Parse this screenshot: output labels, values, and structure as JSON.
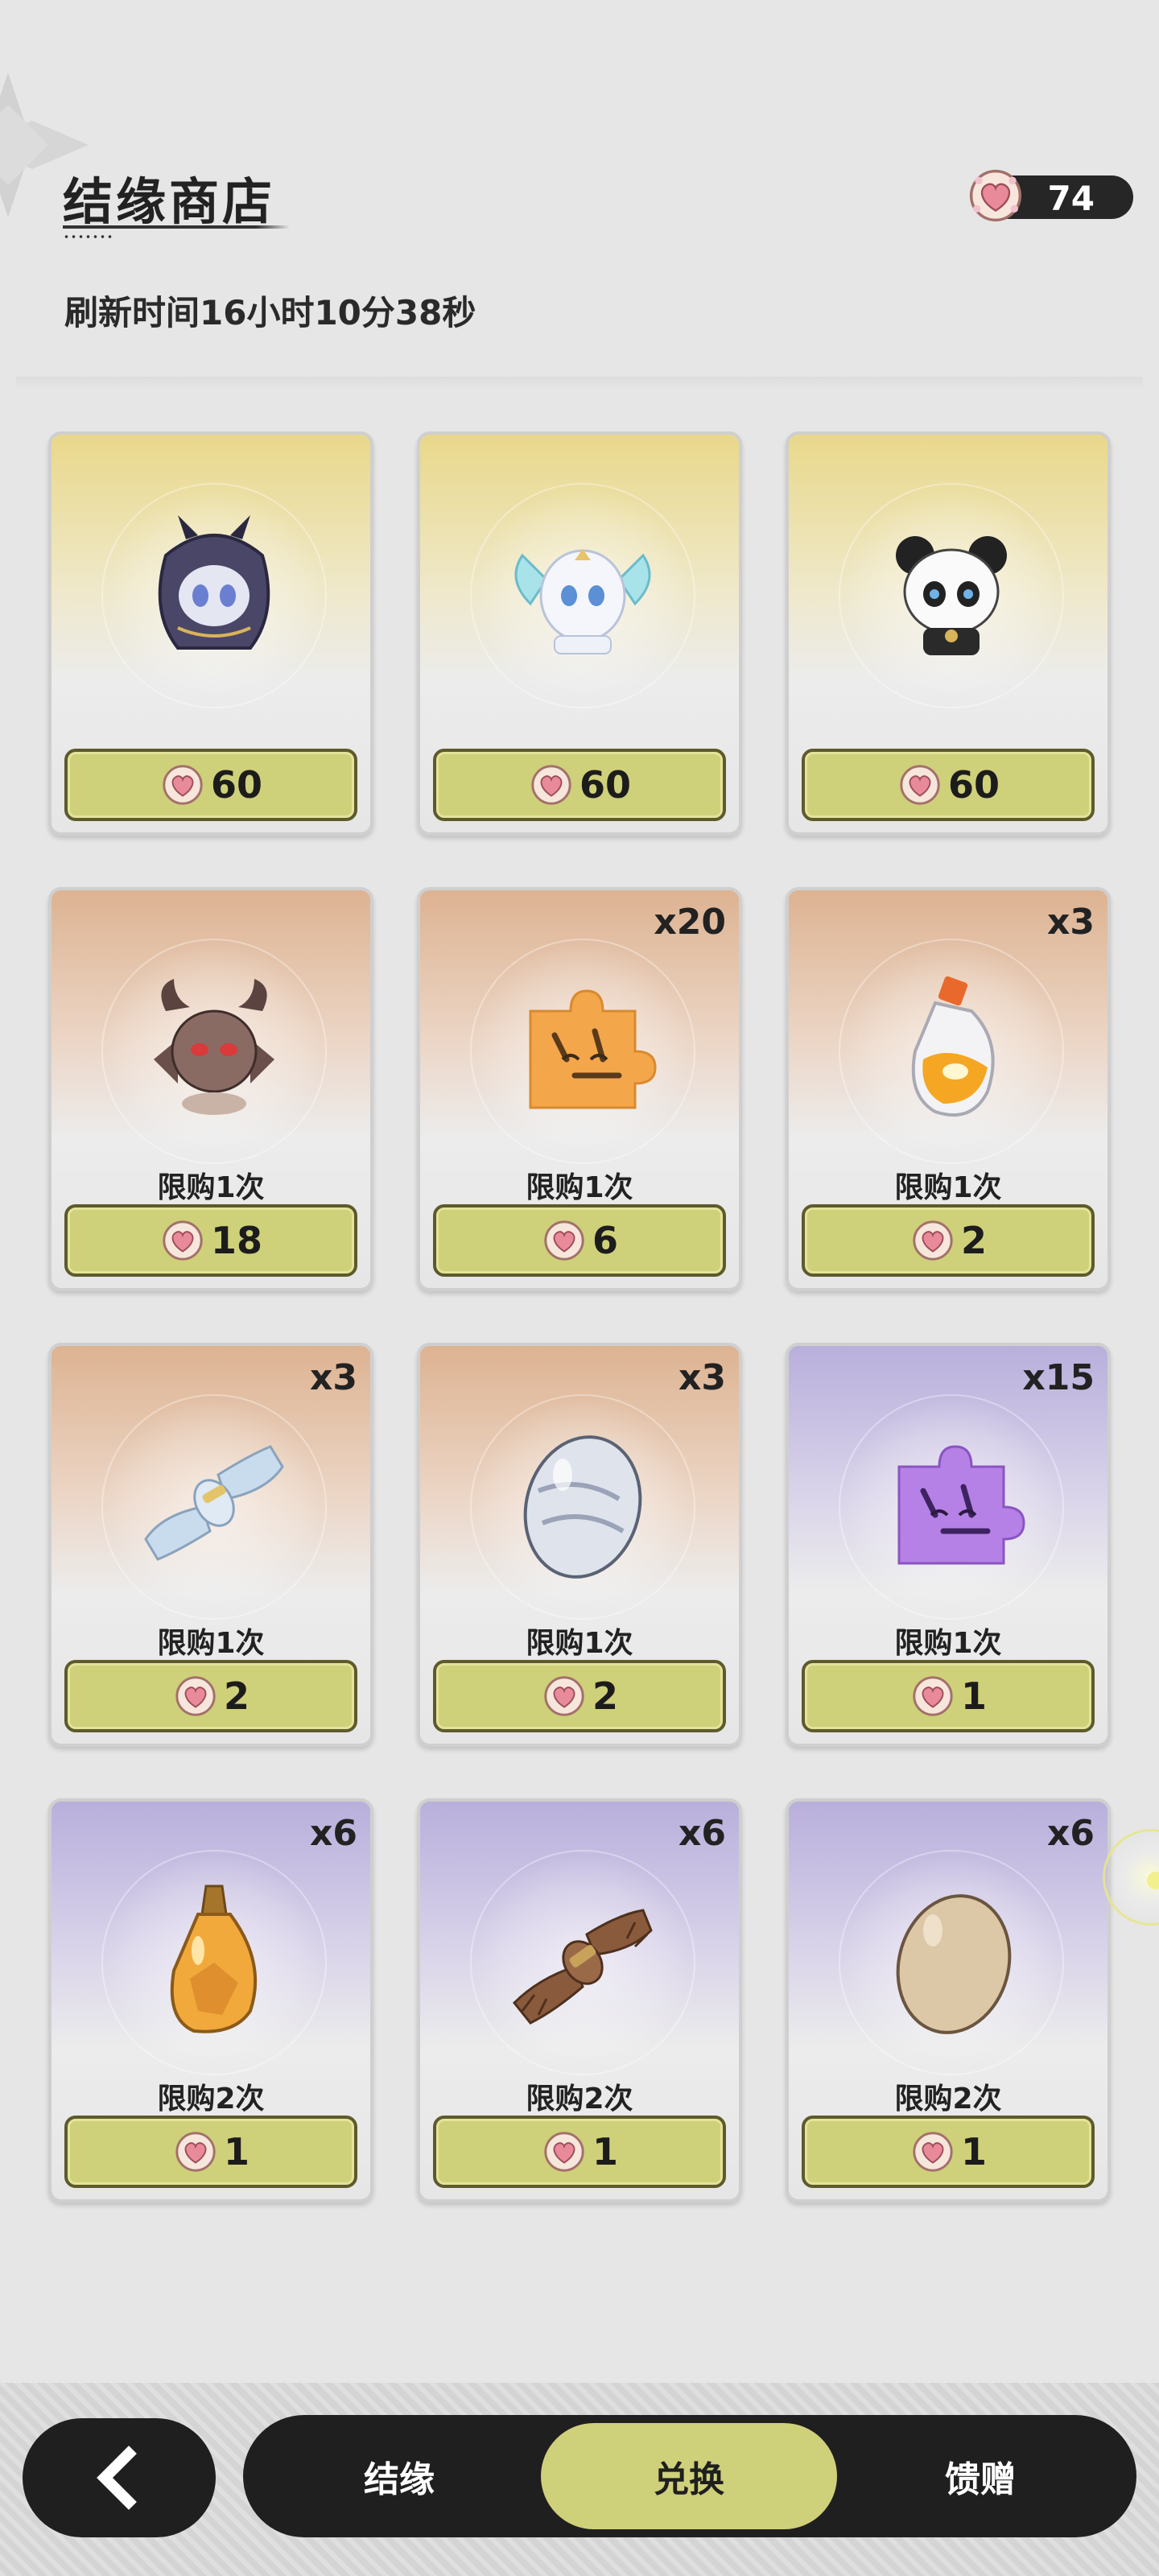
{
  "header": {
    "title": "结缘商店",
    "refresh_text": "刷新时间16小时10分38秒",
    "currency_count": "74",
    "currency_icon": "heart-gem-icon"
  },
  "items": [
    {
      "name": "dark-horned-pet",
      "rarity": "gold",
      "quantity": "",
      "limit": "",
      "price": "60"
    },
    {
      "name": "white-winged-pet",
      "rarity": "gold",
      "quantity": "",
      "limit": "",
      "price": "60"
    },
    {
      "name": "panda-pet",
      "rarity": "gold",
      "quantity": "",
      "limit": "",
      "price": "60"
    },
    {
      "name": "brown-horned-pet",
      "rarity": "orange",
      "quantity": "",
      "limit": "限购1次",
      "price": "18"
    },
    {
      "name": "tiger-puzzle-piece",
      "rarity": "orange",
      "quantity": "x20",
      "limit": "限购1次",
      "price": "6"
    },
    {
      "name": "orange-potion",
      "rarity": "orange",
      "quantity": "x3",
      "limit": "限购1次",
      "price": "2"
    },
    {
      "name": "silver-scroll",
      "rarity": "orange",
      "quantity": "x3",
      "limit": "限购1次",
      "price": "2"
    },
    {
      "name": "silver-egg",
      "rarity": "orange",
      "quantity": "x3",
      "limit": "限购1次",
      "price": "2"
    },
    {
      "name": "purple-puzzle-piece",
      "rarity": "purple",
      "quantity": "x15",
      "limit": "限购1次",
      "price": "1"
    },
    {
      "name": "amber-potion",
      "rarity": "purple",
      "quantity": "x6",
      "limit": "限购2次",
      "price": "1"
    },
    {
      "name": "brown-bundle",
      "rarity": "purple",
      "quantity": "x6",
      "limit": "限购2次",
      "price": "1"
    },
    {
      "name": "beige-egg",
      "rarity": "purple",
      "quantity": "x6",
      "limit": "限购2次",
      "price": "1"
    }
  ],
  "bottom_nav": {
    "back_icon": "chevron-left-icon",
    "tabs": [
      {
        "label": "结缘",
        "active": false
      },
      {
        "label": "兑换",
        "active": true
      },
      {
        "label": "馈赠",
        "active": false
      }
    ]
  },
  "colors": {
    "button_accent": "#cfd07a",
    "dark_bar": "#1f1f1f",
    "rarity_gold": "#e9d88a",
    "rarity_orange": "#ddb392",
    "rarity_purple": "#b9afdc"
  }
}
